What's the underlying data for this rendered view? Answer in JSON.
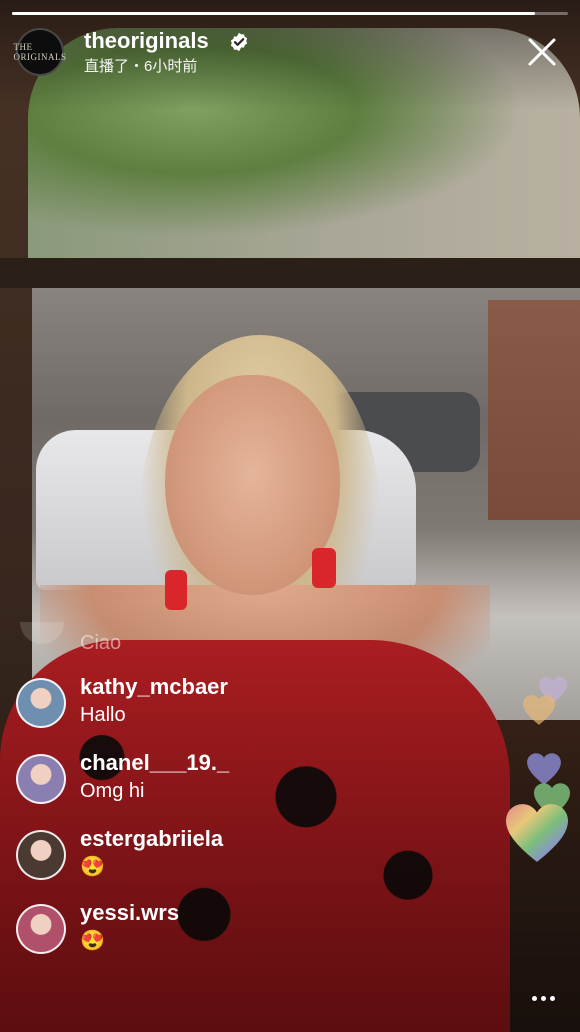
{
  "stream": {
    "progress_fraction": 0.94
  },
  "header": {
    "avatar_text": "THE ORIGINALS",
    "username": "theoriginals",
    "verified": true,
    "subtitle": "直播了・6小时前"
  },
  "comments": {
    "ghost": {
      "text": "Ciao"
    },
    "items": [
      {
        "username": "kathy_mcbaer",
        "text": "Hallo",
        "avatar_color": "#6e8fb0"
      },
      {
        "username": "chanel___19._",
        "text": "Omg hi",
        "avatar_color": "#8a7fb0"
      },
      {
        "username": "estergabriiela",
        "text": "😍",
        "avatar_color": "#4a3a32"
      },
      {
        "username": "yessi.wrs",
        "text": "😍",
        "avatar_color": "#b0506a"
      }
    ]
  },
  "reactions": {
    "icon": "heart-icon",
    "colors": [
      "#c9b3e6",
      "#e7b878",
      "#8c8cd8",
      "#7bbe7b",
      "#e58a8a"
    ]
  },
  "more_icon": "more-dots-icon"
}
